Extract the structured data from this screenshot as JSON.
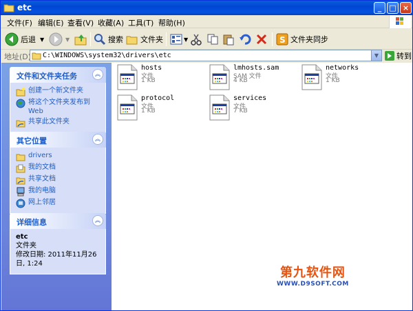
{
  "window": {
    "title": "etc"
  },
  "menu": [
    {
      "label": "文件(F)"
    },
    {
      "label": "编辑(E)"
    },
    {
      "label": "查看(V)"
    },
    {
      "label": "收藏(A)"
    },
    {
      "label": "工具(T)"
    },
    {
      "label": "帮助(H)"
    }
  ],
  "toolbar": {
    "back_label": "后退",
    "search_label": "搜索",
    "folders_label": "文件夹",
    "sync_label": "文件夹同步"
  },
  "address": {
    "label": "地址(D)",
    "value": "C:\\WINDOWS\\system32\\drivers\\etc",
    "go_label": "转到"
  },
  "tasks_panel": {
    "title": "文件和文件夹任务",
    "items": [
      {
        "label": "创建一个新文件夹"
      },
      {
        "label": "将这个文件夹发布到 Web"
      },
      {
        "label": "共享此文件夹"
      }
    ]
  },
  "places_panel": {
    "title": "其它位置",
    "items": [
      {
        "label": "drivers"
      },
      {
        "label": "我的文档"
      },
      {
        "label": "共享文档"
      },
      {
        "label": "我的电脑"
      },
      {
        "label": "网上邻居"
      }
    ]
  },
  "details_panel": {
    "title": "详细信息",
    "name": "etc",
    "type": "文件夹",
    "modified": "修改日期: 2011年11月26日, 1:24"
  },
  "files": [
    {
      "name": "hosts",
      "type": "文件",
      "size": "1 KB"
    },
    {
      "name": "lmhosts.sam",
      "type": "SAM 文件",
      "size": "4 KB"
    },
    {
      "name": "networks",
      "type": "文件",
      "size": "1 KB"
    },
    {
      "name": "protocol",
      "type": "文件",
      "size": "1 KB"
    },
    {
      "name": "services",
      "type": "文件",
      "size": "7 KB"
    }
  ],
  "watermark": {
    "line1": "第九软件网",
    "line2": "WWW.D9SOFT.COM"
  }
}
